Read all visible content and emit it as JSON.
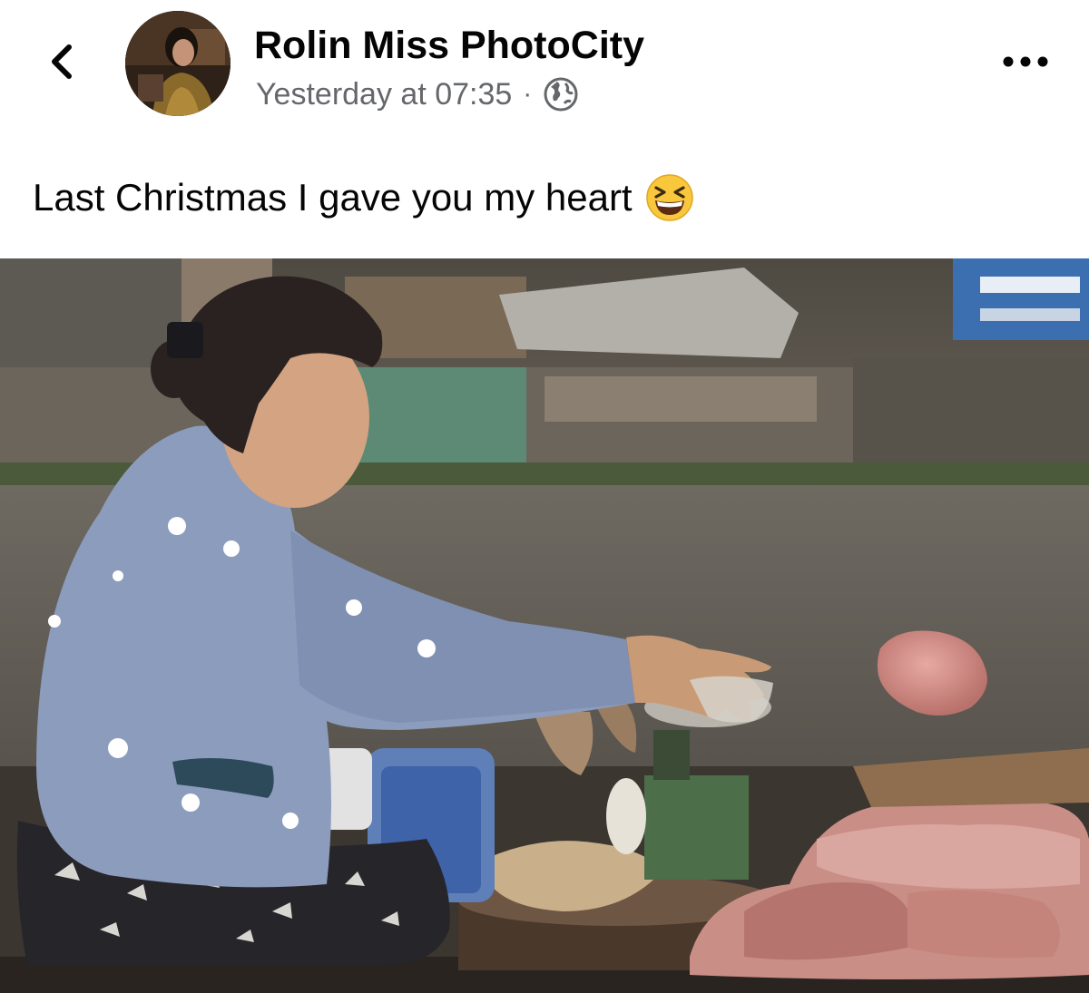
{
  "header": {
    "back_icon": "chevron-left-icon",
    "author_name": "Rolin Miss PhotoCity",
    "timestamp": "Yesterday at 07:35",
    "separator": "·",
    "audience_icon": "globe-icon",
    "more_icon": "more-horizontal-icon"
  },
  "post": {
    "text": "Last Christmas I gave you my heart",
    "emoji": "grinning-squinting-face-emoji"
  },
  "photo": {
    "subject": "woman-selling-meat-on-boat"
  },
  "colors": {
    "text_primary": "#050505",
    "text_secondary": "#65676b",
    "background": "#ffffff"
  }
}
